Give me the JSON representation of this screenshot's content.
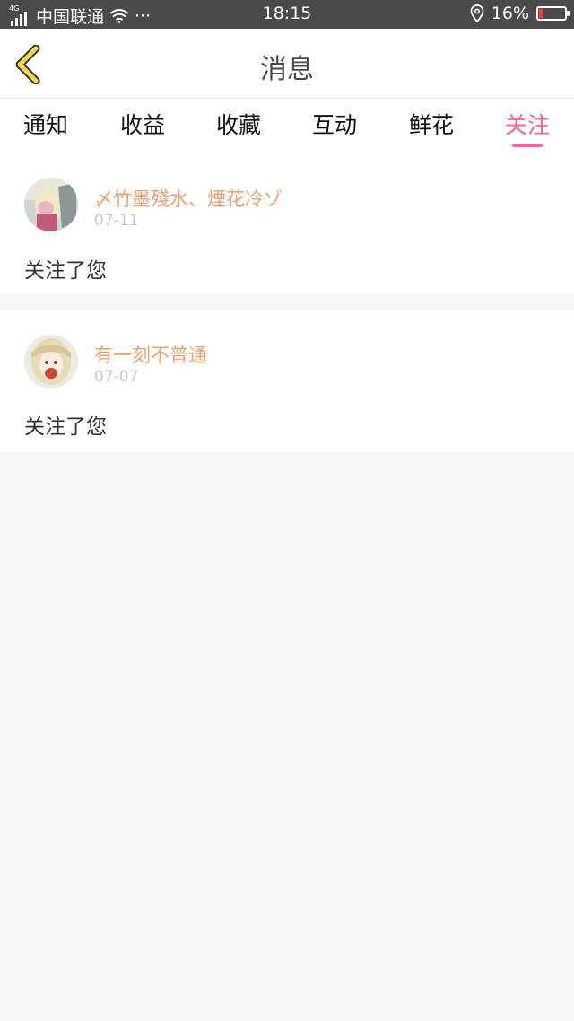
{
  "status_bar": {
    "network_type": "4G",
    "carrier": "中国联通",
    "more": "···",
    "time": "18:15",
    "battery_percent": "16%",
    "battery_level": 0.16
  },
  "header": {
    "title": "消息"
  },
  "tabs": [
    {
      "label": "通知",
      "active": false
    },
    {
      "label": "收益",
      "active": false
    },
    {
      "label": "收藏",
      "active": false
    },
    {
      "label": "互动",
      "active": false
    },
    {
      "label": "鲜花",
      "active": false
    },
    {
      "label": "关注",
      "active": true
    }
  ],
  "colors": {
    "accent": "#f0669a",
    "username": "#f0a070",
    "date": "#c8c8c8",
    "status_bar_bg": "#4a4a4a",
    "battery_low": "#ff3b30"
  },
  "items": [
    {
      "username": "〆竹墨殘水、煙花冷ゾ",
      "date": "07-11",
      "message": "关注了您",
      "avatar": "user-avatar"
    },
    {
      "username": "有一刻不普通",
      "date": "07-07",
      "message": "关注了您",
      "avatar": "user-avatar"
    }
  ]
}
